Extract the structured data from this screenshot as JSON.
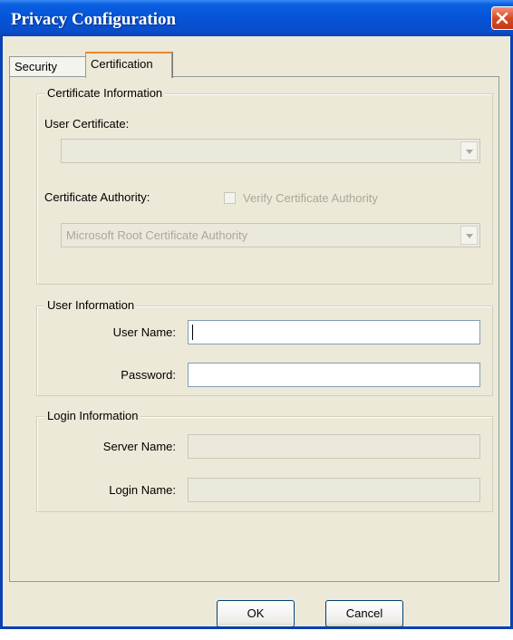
{
  "window": {
    "title": "Privacy Configuration"
  },
  "tabs": [
    {
      "label": "Security",
      "selected": false
    },
    {
      "label": "Certification",
      "selected": true
    }
  ],
  "certificate_info": {
    "group_title": "Certificate Information",
    "user_certificate_label": "User Certificate:",
    "user_certificate_value": "",
    "certificate_authority_label": "Certificate Authority:",
    "verify_ca_label": "Verify Certificate Authority",
    "verify_ca_checked": false,
    "ca_value": "Microsoft Root Certificate Authority"
  },
  "user_info": {
    "group_title": "User Information",
    "user_name_label": "User Name:",
    "user_name_value": "",
    "password_label": "Password:",
    "password_value": ""
  },
  "login_info": {
    "group_title": "Login Information",
    "server_name_label": "Server Name:",
    "server_name_value": "",
    "login_name_label": "Login Name:",
    "login_name_value": ""
  },
  "buttons": {
    "ok_label": "OK",
    "cancel_label": "Cancel"
  },
  "colors": {
    "titlebar": "#0553d6",
    "dialog_bg": "#ece9d8",
    "close_button": "#d94a24",
    "selected_tab_accent": "#e68b2c"
  }
}
